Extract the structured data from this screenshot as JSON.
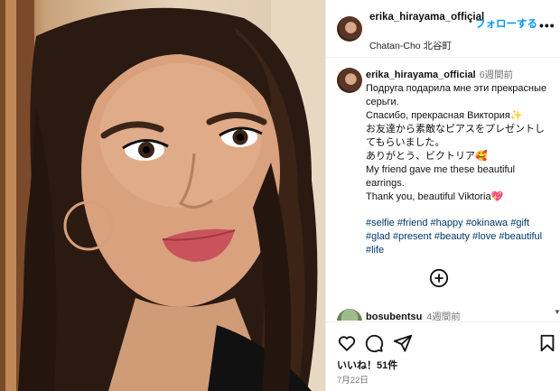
{
  "post": {
    "username_header": "erika_hirayama_official",
    "follow_label": "フォローする",
    "dot": "•",
    "more": "•••",
    "location": "Chatan-Cho 北谷町"
  },
  "caption": {
    "username": "erika_hirayama_official",
    "time": "6週間前",
    "lines": [
      "Подруга подарила мне эти прекрасные серьги.",
      "Спасибо, прекрасная Виктория✨",
      "お友達から素敵なピアスをプレゼントしてもらいました。",
      "ありがとう、ビクトリア🥰",
      "My friend gave me these beautiful earrings.",
      "Thank you, beautiful Viktoria💖"
    ],
    "hashtags": "#selfie #friend #happy #okinawa #gift #glad #present #beauty #love #beautiful #life"
  },
  "comment": {
    "username": "bosubentsu",
    "time": "4週間前"
  },
  "footer": {
    "likes": "いいね！51件",
    "date": "7月22日"
  },
  "icons": [
    "heart-icon",
    "comment-icon",
    "share-icon",
    "bookmark-icon",
    "add-circle-icon",
    "more-icon"
  ]
}
